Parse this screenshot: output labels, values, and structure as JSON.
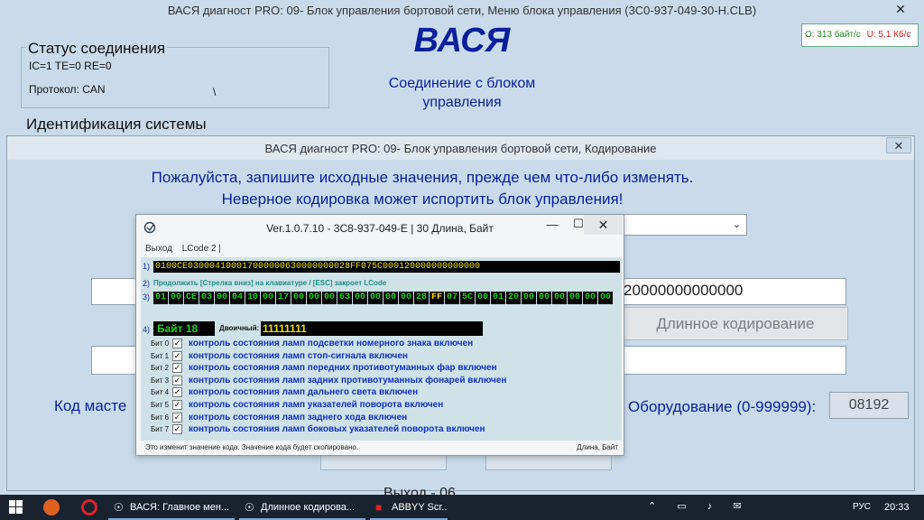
{
  "main": {
    "title": "ВАСЯ диагност PRO: 09- Блок управления бортовой сети,  Меню блока управления (3C0-937-049-30-H.CLB)",
    "close": "✕",
    "logo": "ВАСЯ",
    "connection_status": "Соединение с блоком управления",
    "connection_group": {
      "label": "Статус соединения",
      "counters": "IC=1  TE=0   RE=0",
      "protocol": "Протокол: CAN",
      "spinner": "\\"
    },
    "rate": {
      "speed": "O: 313 байт/с",
      "voltage": "U: 5,1 Кб/с"
    },
    "identification_label": "Идентификация системы"
  },
  "coding": {
    "title": "ВАСЯ диагност PRO: 09- Блок управления бортовой сети,  Кодирование",
    "close": "✕",
    "warning_line1": "Пожалуйста, запишите исходные значения, прежде чем что-либо изменять.",
    "warning_line2": "Неверное кодировка может испортить блок управления!",
    "select_arrow": "⌄",
    "code_value_tail": "20000000000000",
    "long_coding_button": "Длинное кодирование",
    "master_label": "Код масте",
    "equipment_label": "Оборудование (0-999999):",
    "equipment_value": "08192",
    "cut_text": "Выход - 06"
  },
  "lcode": {
    "title": "Ver.1.0.7.10 -   3C8-937-049-E | 30 Длина, Байт",
    "minimize": "—",
    "maximize": "☐",
    "close": "✕",
    "menu": [
      "Выход",
      "LCode 2 |"
    ],
    "row_numbers": [
      "1)",
      "2)",
      "3)",
      "4)"
    ],
    "hex_string": "0100CE030004100017000000630000000028FF075C000120000000000000",
    "hint": "Продолжить [Стрелка вниз] на клавиатуре / [ESC] закроет LCode",
    "bytes": [
      "01",
      "00",
      "CE",
      "03",
      "00",
      "04",
      "10",
      "00",
      "17",
      "00",
      "00",
      "00",
      "63",
      "00",
      "00",
      "00",
      "00",
      "28",
      "FF",
      "07",
      "5C",
      "00",
      "01",
      "20",
      "00",
      "00",
      "00",
      "00",
      "00",
      "00"
    ],
    "selected_byte_index": 18,
    "byte_label": "Байт 18",
    "binary_label": "Двоичный:",
    "binary_value": "11111111",
    "bits": [
      {
        "name": "Бит 0",
        "checked": true,
        "text": "контроль состояния ламп подсветки номерного знака включен"
      },
      {
        "name": "Бит 1",
        "checked": true,
        "text": "контроль состояния ламп стоп-сигнала включен"
      },
      {
        "name": "Бит 2",
        "checked": true,
        "text": "контроль состояния ламп передних противотуманных фар включен"
      },
      {
        "name": "Бит 3",
        "checked": true,
        "text": "контроль состояния ламп задних противотуманных фонарей включен"
      },
      {
        "name": "Бит 4",
        "checked": true,
        "text": "контроль состояния ламп дальнего света включен"
      },
      {
        "name": "Бит 5",
        "checked": true,
        "text": "контроль состояния ламп указателей поворота включен"
      },
      {
        "name": "Бит 6",
        "checked": true,
        "text": "контроль состояния ламп заднего хода включен"
      },
      {
        "name": "Бит 7",
        "checked": true,
        "text": "контроль состояния ламп боковых указателей поворота включен"
      }
    ],
    "status_left": "Это изменит значение кода.  Значение кода будет скопировано.",
    "status_right": "Длина, Байт"
  },
  "taskbar": {
    "apps": [
      "ВАСЯ:  Главное мен...",
      "Длинное кодирова...",
      "ABBYY Scr..."
    ],
    "tray_icons": "⌃ ▭ ♪ ✉",
    "language": "РУС",
    "clock": "20:33"
  }
}
